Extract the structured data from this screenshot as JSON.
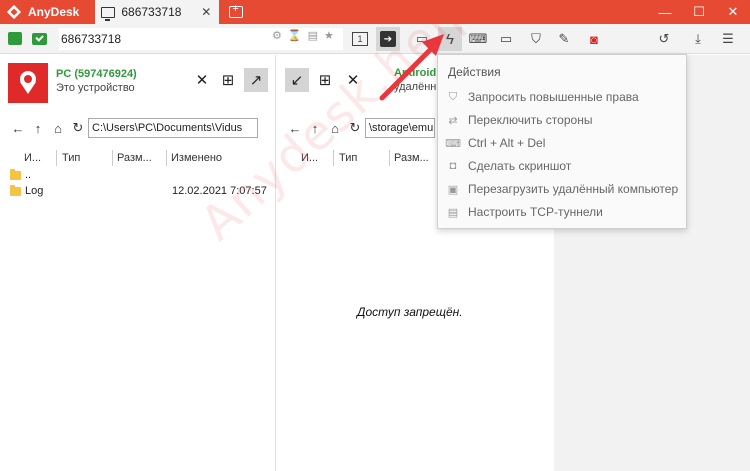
{
  "titlebar": {
    "app_name": "AnyDesk",
    "tab_label": "686733718",
    "tab_close": "✕"
  },
  "window_controls": {
    "minimize": "—",
    "maximize": "☐",
    "close": "✕"
  },
  "address": {
    "value": "686733718"
  },
  "toolbar": {
    "monitor_number": "1"
  },
  "local": {
    "device_name": "PC (597476924)",
    "device_subtitle": "Это устройство",
    "path": "C:\\Users\\PC\\Documents\\Vidus",
    "columns": [
      "И...",
      "Тип",
      "Разм...",
      "Изменено"
    ],
    "rows": [
      {
        "name": "..",
        "modified": ""
      },
      {
        "name": "Log",
        "modified": "12.02.2021 7:07:57"
      }
    ]
  },
  "remote": {
    "device_name": "Android",
    "device_subtitle": "удалённ",
    "path": "\\storage\\emu",
    "columns": [
      "И...",
      "Тип",
      "Разм..."
    ],
    "access_denied": "Доступ запрещён."
  },
  "actions_menu": {
    "title": "Действия",
    "items": [
      {
        "label": "Запросить повышенные права",
        "icon": "shield-icon"
      },
      {
        "label": "Переключить стороны",
        "icon": "swap-icon"
      },
      {
        "label": "Ctrl + Alt + Del",
        "icon": "keyboard-icon"
      },
      {
        "label": "Сделать скриншот",
        "icon": "camera-icon"
      },
      {
        "label": "Перезагрузить удалённый компьютер",
        "icon": "restart-icon"
      },
      {
        "label": "Настроить TCP-туннели",
        "icon": "tunnel-icon"
      }
    ]
  },
  "watermark": "Anydesk.help",
  "colors": {
    "brand": "#e64a32",
    "online": "#2e9a3a",
    "arrow": "#e8363c"
  }
}
